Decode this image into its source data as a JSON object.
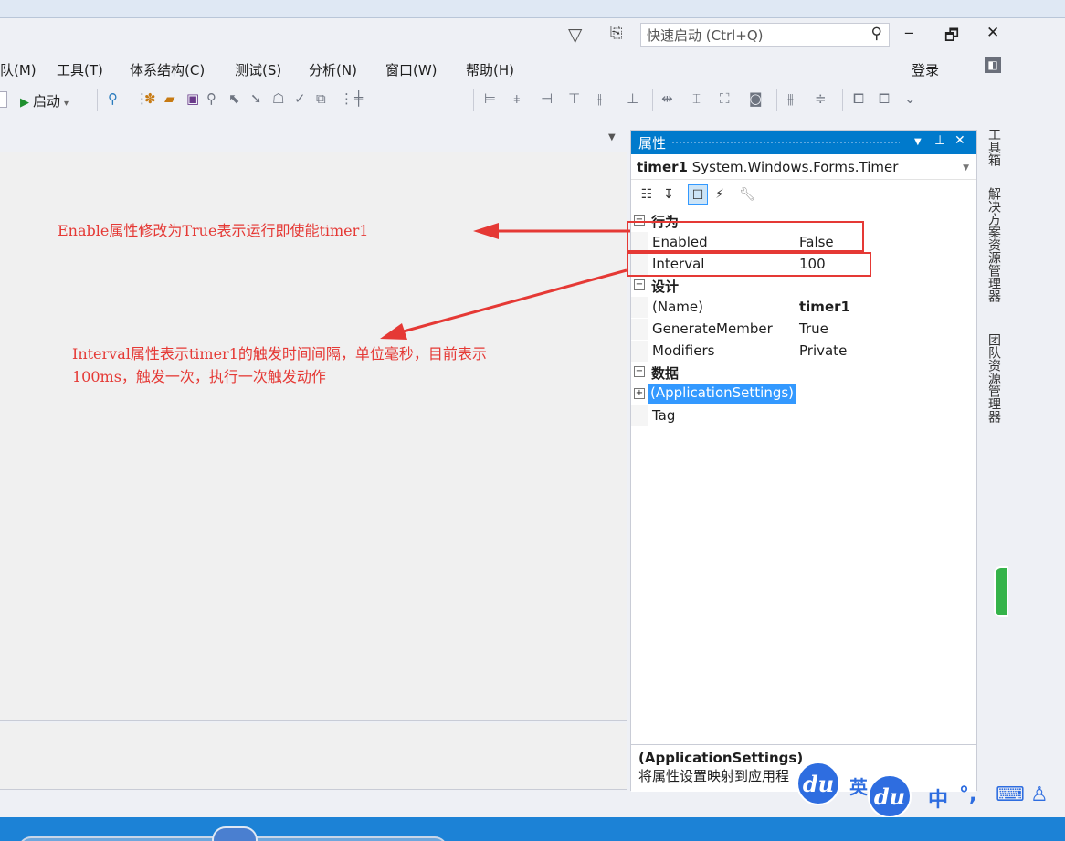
{
  "titlebar": {
    "filter_icon": "filter-icon",
    "user_icon": "feedback-icon",
    "quick_launch_placeholder": "快速启动 (Ctrl+Q)",
    "minimize": "‒",
    "restore": "🗗",
    "close": "✕"
  },
  "menu": {
    "items": [
      "队(M)",
      "工具(T)",
      "体系结构(C)",
      "测试(S)",
      "分析(N)",
      "窗口(W)",
      "帮助(H)"
    ],
    "login": "登录"
  },
  "toolbar": {
    "start_label": "启动",
    "start_dropdown": "▾"
  },
  "annotations": {
    "enable_note": "Enable属性修改为True表示运行即使能timer1",
    "interval_note_line1": "Interval属性表示timer1的触发时间间隔，单位毫秒，目前表示",
    "interval_note_line2": "100ms，触发一次，执行一次触发动作"
  },
  "properties": {
    "title": "属性",
    "pin": "ꟷ",
    "close": "✕",
    "object_name": "timer1",
    "object_type": "System.Windows.Forms.Timer",
    "categories": [
      {
        "label": "行为",
        "rows": [
          {
            "name": "Enabled",
            "value": "False"
          },
          {
            "name": "Interval",
            "value": "100"
          }
        ]
      },
      {
        "label": "设计",
        "rows": [
          {
            "name": "(Name)",
            "value": "timer1"
          },
          {
            "name": "GenerateMember",
            "value": "True"
          },
          {
            "name": "Modifiers",
            "value": "Private"
          }
        ]
      },
      {
        "label": "数据",
        "rows": [
          {
            "name": "(ApplicationSettings)",
            "value": ""
          },
          {
            "name": "Tag",
            "value": ""
          }
        ]
      }
    ],
    "description_title": "(ApplicationSettings)",
    "description_text": "将属性设置映射到应用程"
  },
  "side_tabs": [
    "工具箱",
    "解决方案资源管理器",
    "团队资源管理器"
  ],
  "ime": {
    "du_logo": "du",
    "english_char": "英",
    "chinese_char": "中",
    "punct": "°,",
    "keyboard_icon": "keyboard-icon",
    "user_icon": "user-icon"
  },
  "colors": {
    "accent": "#007acc",
    "annotation_red": "#e53935",
    "ime_blue": "#2e6de0",
    "taskbar": "#1c82d6"
  }
}
